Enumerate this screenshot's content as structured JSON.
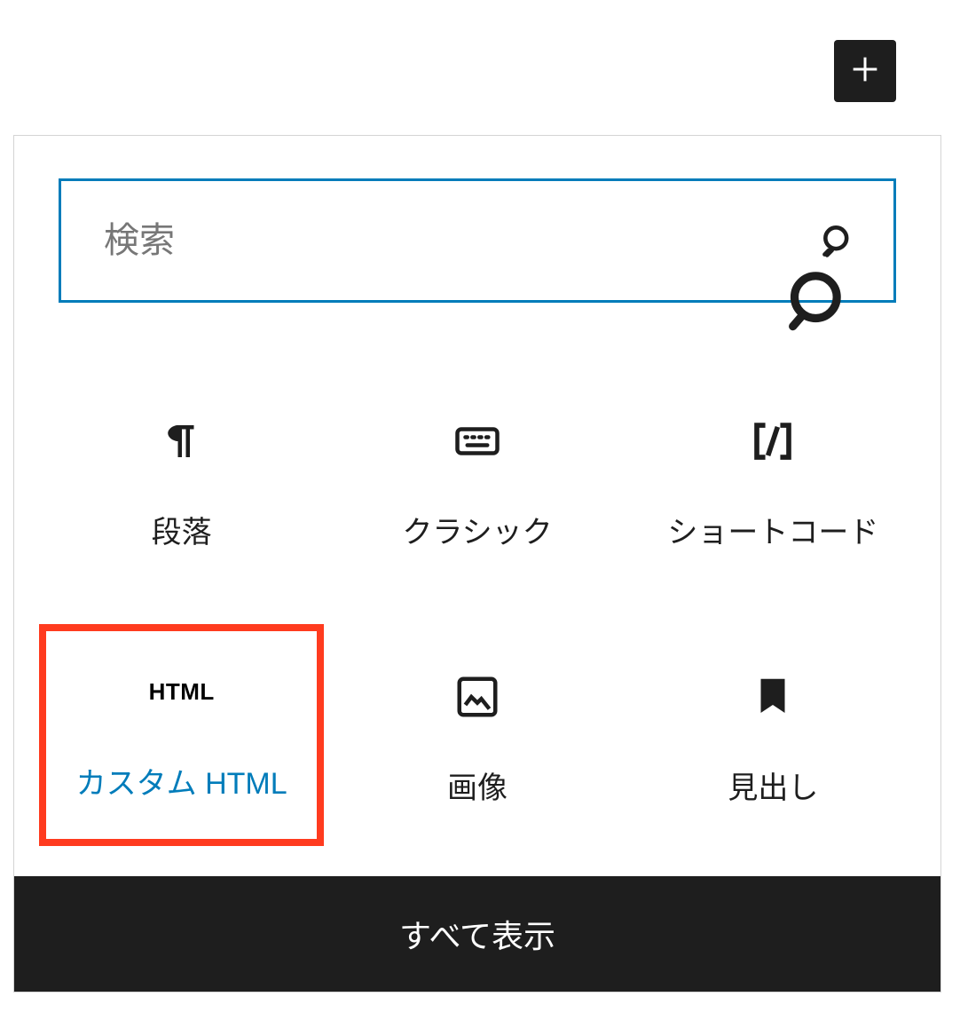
{
  "add_button": {
    "label": "Add"
  },
  "search": {
    "placeholder": "検索"
  },
  "blocks": [
    {
      "label": "段落"
    },
    {
      "label": "クラシック"
    },
    {
      "label": "ショートコード"
    },
    {
      "label": "カスタム HTML",
      "icon_text": "HTML"
    },
    {
      "label": "画像"
    },
    {
      "label": "見出し"
    }
  ],
  "show_all_label": "すべて表示"
}
